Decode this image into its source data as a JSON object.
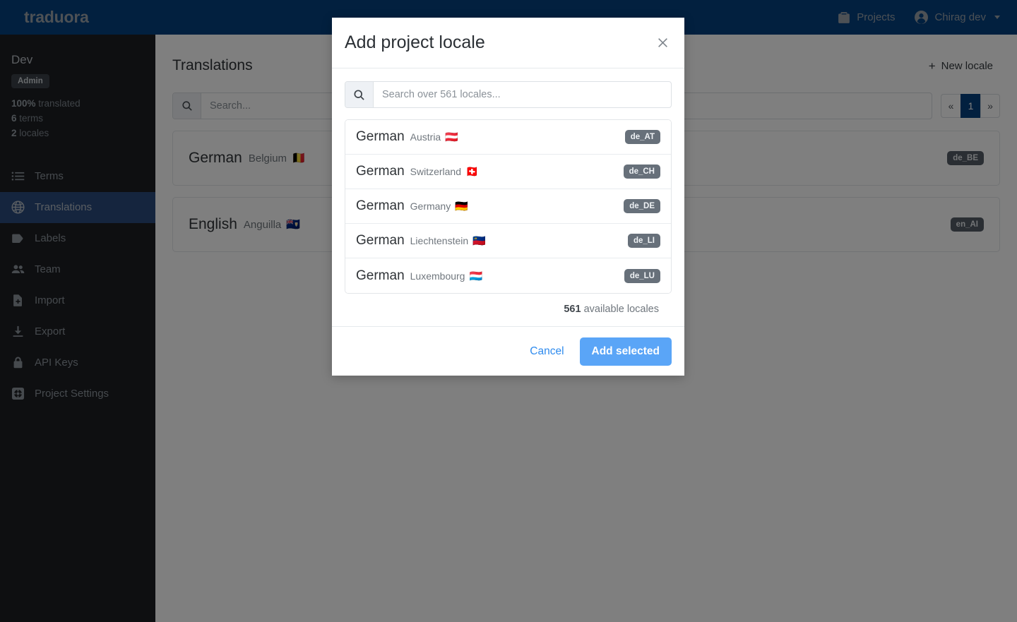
{
  "navbar": {
    "brand": "traduora",
    "projects_label": "Projects",
    "user_label": "Chirag dev",
    "background_color": "#04407f"
  },
  "sidebar": {
    "project_name": "Dev",
    "role_badge": "Admin",
    "stats": {
      "translated_value": "100%",
      "translated_label": "translated",
      "terms_value": "6",
      "terms_label": "terms",
      "locales_value": "2",
      "locales_label": "locales"
    },
    "items": [
      {
        "label": "Terms",
        "icon": "list-icon",
        "active": false
      },
      {
        "label": "Translations",
        "icon": "globe-icon",
        "active": true
      },
      {
        "label": "Labels",
        "icon": "tag-icon",
        "active": false
      },
      {
        "label": "Team",
        "icon": "people-icon",
        "active": false
      },
      {
        "label": "Import",
        "icon": "file-import-icon",
        "active": false
      },
      {
        "label": "Export",
        "icon": "download-icon",
        "active": false
      },
      {
        "label": "API Keys",
        "icon": "lock-icon",
        "active": false
      },
      {
        "label": "Project Settings",
        "icon": "gear-icon",
        "active": false
      }
    ],
    "active_color": "#2b4a7c"
  },
  "main": {
    "page_title": "Translations",
    "new_locale_label": "New locale",
    "search": {
      "value": "",
      "placeholder": "Search..."
    },
    "pagination": {
      "prev": "«",
      "current": "1",
      "next": "»"
    },
    "locales": [
      {
        "language": "German",
        "country": "Belgium",
        "flag": "🇧🇪",
        "code": "de_BE"
      },
      {
        "language": "English",
        "country": "Anguilla",
        "flag": "🇦🇮",
        "code": "en_AI"
      }
    ]
  },
  "modal": {
    "title": "Add project locale",
    "close_icon": "close-icon",
    "search": {
      "value": "",
      "placeholder": "Search over 561 locales..."
    },
    "results": [
      {
        "language": "German",
        "country": "Austria",
        "flag": "🇦🇹",
        "code": "de_AT"
      },
      {
        "language": "German",
        "country": "Switzerland",
        "flag": "🇨🇭",
        "code": "de_CH"
      },
      {
        "language": "German",
        "country": "Germany",
        "flag": "🇩🇪",
        "code": "de_DE"
      },
      {
        "language": "German",
        "country": "Liechtenstein",
        "flag": "🇱🇮",
        "code": "de_LI"
      },
      {
        "language": "German",
        "country": "Luxembourg",
        "flag": "🇱🇺",
        "code": "de_LU"
      }
    ],
    "available_count": "561",
    "available_label": "available locales",
    "cancel_label": "Cancel",
    "add_label": "Add selected",
    "accent_color": "#5aa5f7"
  }
}
